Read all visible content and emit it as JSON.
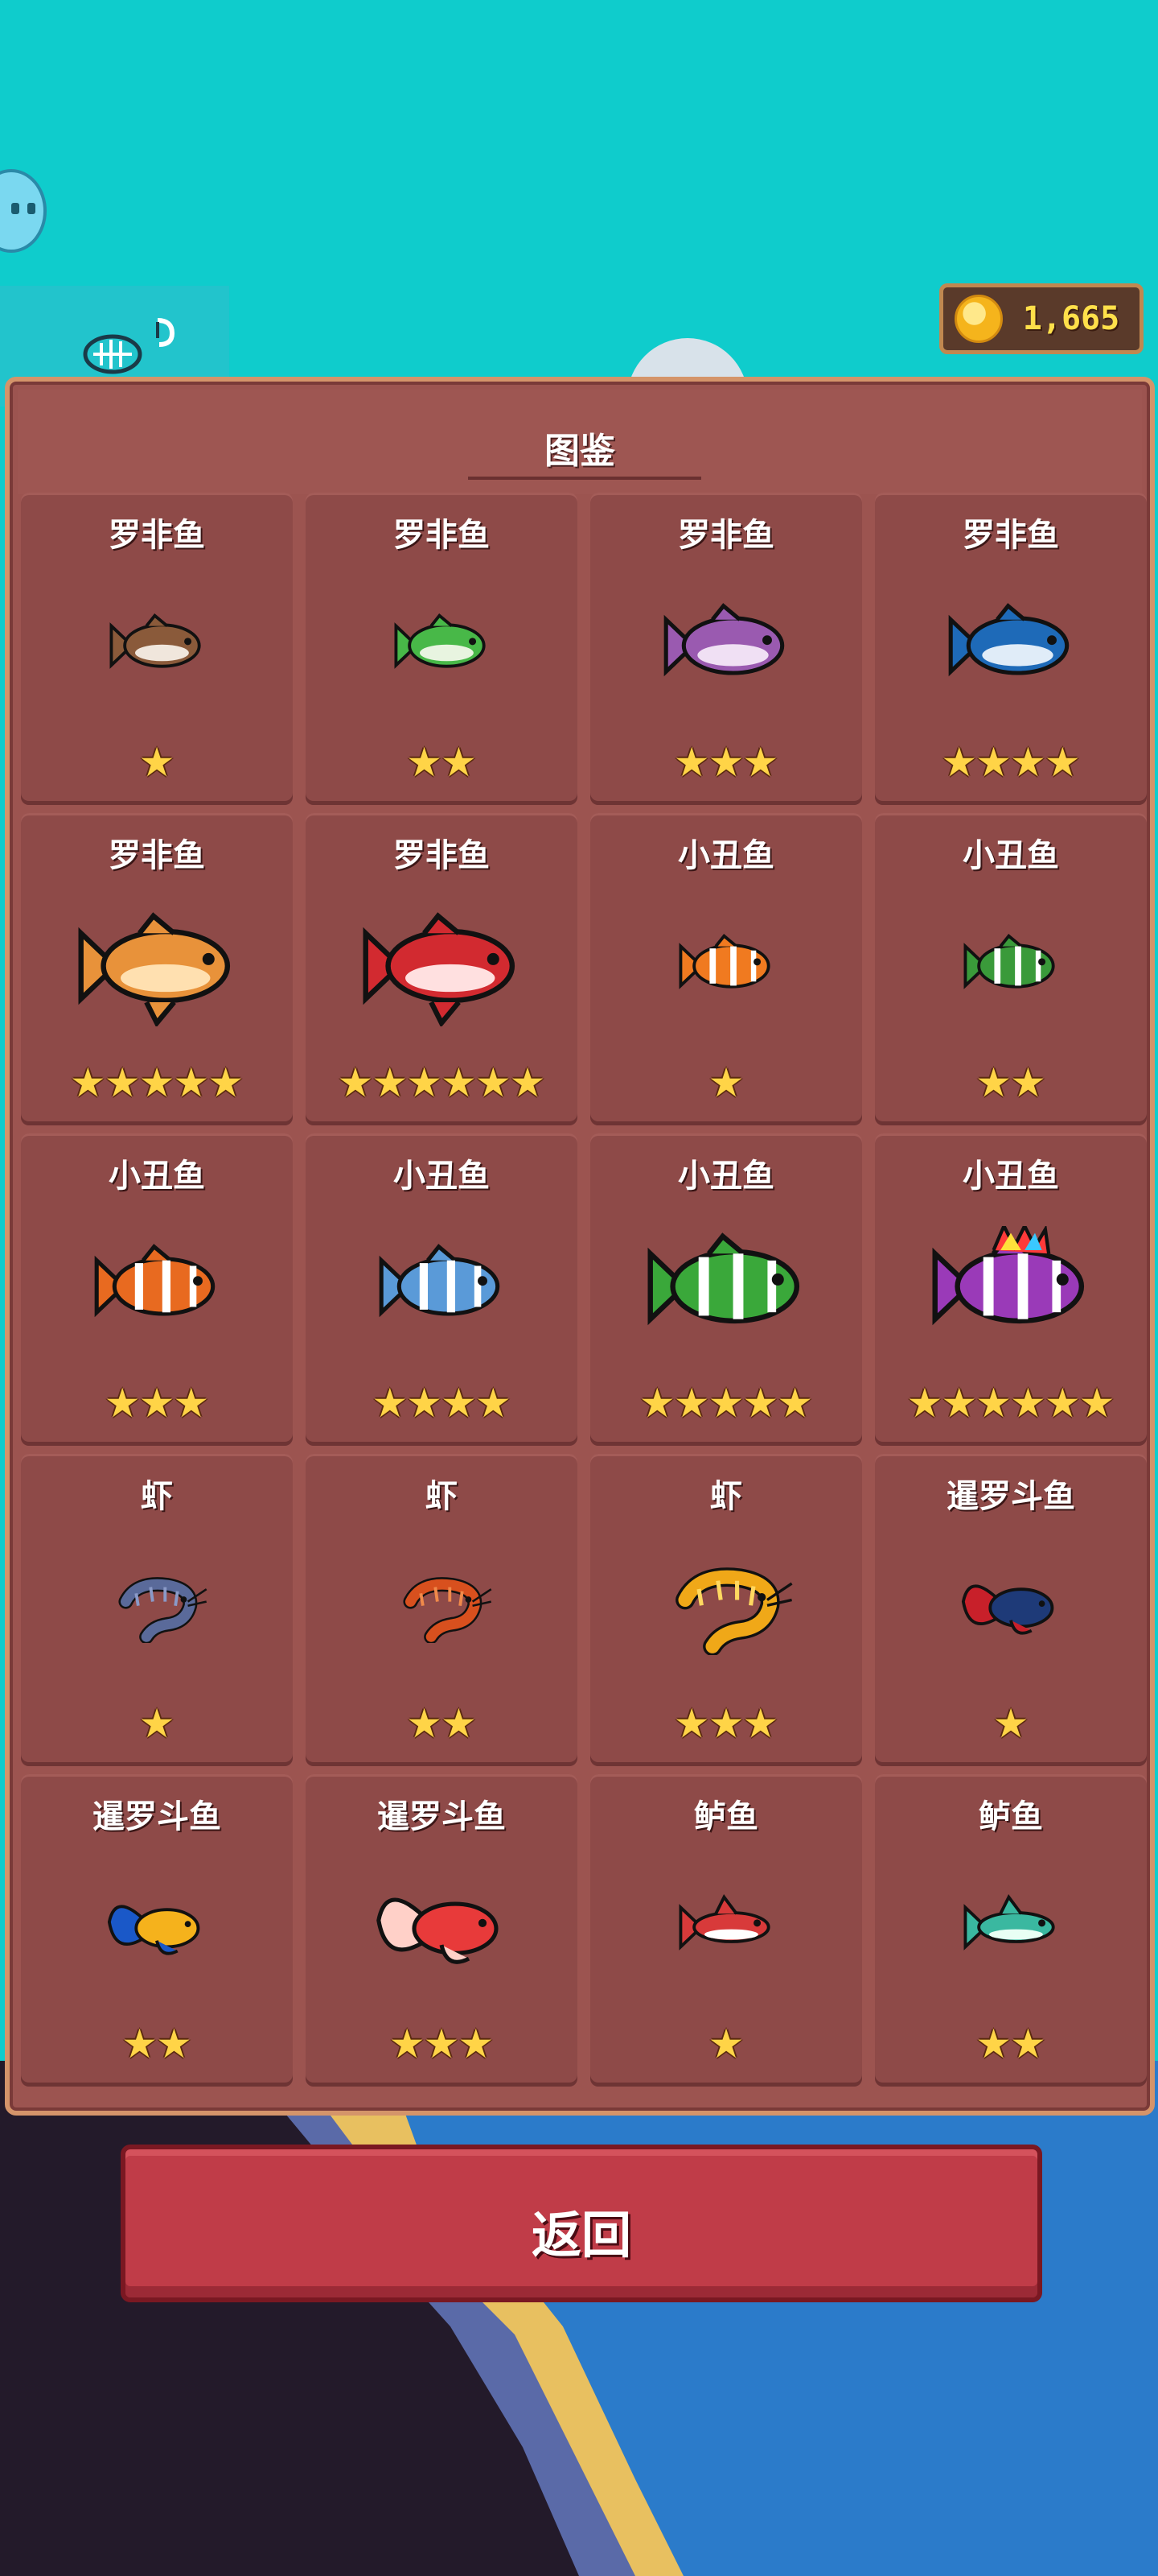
{
  "header": {
    "coins": "1,665",
    "coin_icon": "gold-coin-icon",
    "hook_icon": "fish-skeleton-hook-icon",
    "avatar_icon": "bubble-face-icon"
  },
  "encyclopedia": {
    "title": "图鉴",
    "entries": [
      {
        "name": "罗非鱼",
        "stars": 1,
        "fish": "tilapia",
        "colors": [
          "#8a5a3a",
          "#f0e6dc"
        ]
      },
      {
        "name": "罗非鱼",
        "stars": 2,
        "fish": "tilapia",
        "colors": [
          "#48b848",
          "#e8f4e0"
        ]
      },
      {
        "name": "罗非鱼",
        "stars": 3,
        "fish": "tilapia",
        "colors": [
          "#9a5ab0",
          "#f0e0f4"
        ]
      },
      {
        "name": "罗非鱼",
        "stars": 4,
        "fish": "tilapia",
        "colors": [
          "#1e6ab8",
          "#e0ecf8"
        ]
      },
      {
        "name": "罗非鱼",
        "stars": 5,
        "fish": "tilapia-fancy",
        "colors": [
          "#e8923a",
          "#ffe0b0"
        ]
      },
      {
        "name": "罗非鱼",
        "stars": 6,
        "fish": "tilapia-fancy",
        "colors": [
          "#d22a30",
          "#ffe0e0"
        ]
      },
      {
        "name": "小丑鱼",
        "stars": 1,
        "fish": "clownfish",
        "colors": [
          "#f07a20",
          "#ffffff"
        ]
      },
      {
        "name": "小丑鱼",
        "stars": 2,
        "fish": "clownfish",
        "colors": [
          "#3a9a3a",
          "#ffffff"
        ]
      },
      {
        "name": "小丑鱼",
        "stars": 3,
        "fish": "clownfish",
        "colors": [
          "#e86a20",
          "#ffffff"
        ]
      },
      {
        "name": "小丑鱼",
        "stars": 4,
        "fish": "clownfish",
        "colors": [
          "#5a9ad8",
          "#ffffff"
        ]
      },
      {
        "name": "小丑鱼",
        "stars": 5,
        "fish": "clownfish",
        "colors": [
          "#3aa83a",
          "#ffffff"
        ]
      },
      {
        "name": "小丑鱼",
        "stars": 6,
        "fish": "clownfish-rainbow",
        "colors": [
          "#9a3ab8",
          "#ffffff"
        ]
      },
      {
        "name": "虾",
        "stars": 1,
        "fish": "shrimp",
        "colors": [
          "#5a6a9a",
          "#8a9ac8"
        ]
      },
      {
        "name": "虾",
        "stars": 2,
        "fish": "shrimp",
        "colors": [
          "#d8501e",
          "#f08a4a"
        ]
      },
      {
        "name": "虾",
        "stars": 3,
        "fish": "shrimp",
        "colors": [
          "#f0a818",
          "#ffd860"
        ]
      },
      {
        "name": "暹罗斗鱼",
        "stars": 1,
        "fish": "betta",
        "colors": [
          "#1e3a78",
          "#c8202a"
        ]
      },
      {
        "name": "暹罗斗鱼",
        "stars": 2,
        "fish": "betta",
        "colors": [
          "#f5b21c",
          "#1a58c8"
        ]
      },
      {
        "name": "暹罗斗鱼",
        "stars": 3,
        "fish": "betta",
        "colors": [
          "#e83a3a",
          "#ffd0c8"
        ]
      },
      {
        "name": "鲈鱼",
        "stars": 1,
        "fish": "perch",
        "colors": [
          "#d83a3a",
          "#ffffff"
        ]
      },
      {
        "name": "鲈鱼",
        "stars": 2,
        "fish": "perch",
        "colors": [
          "#3ab8a0",
          "#e8fff4"
        ]
      }
    ]
  },
  "back_button": {
    "label": "返回"
  }
}
